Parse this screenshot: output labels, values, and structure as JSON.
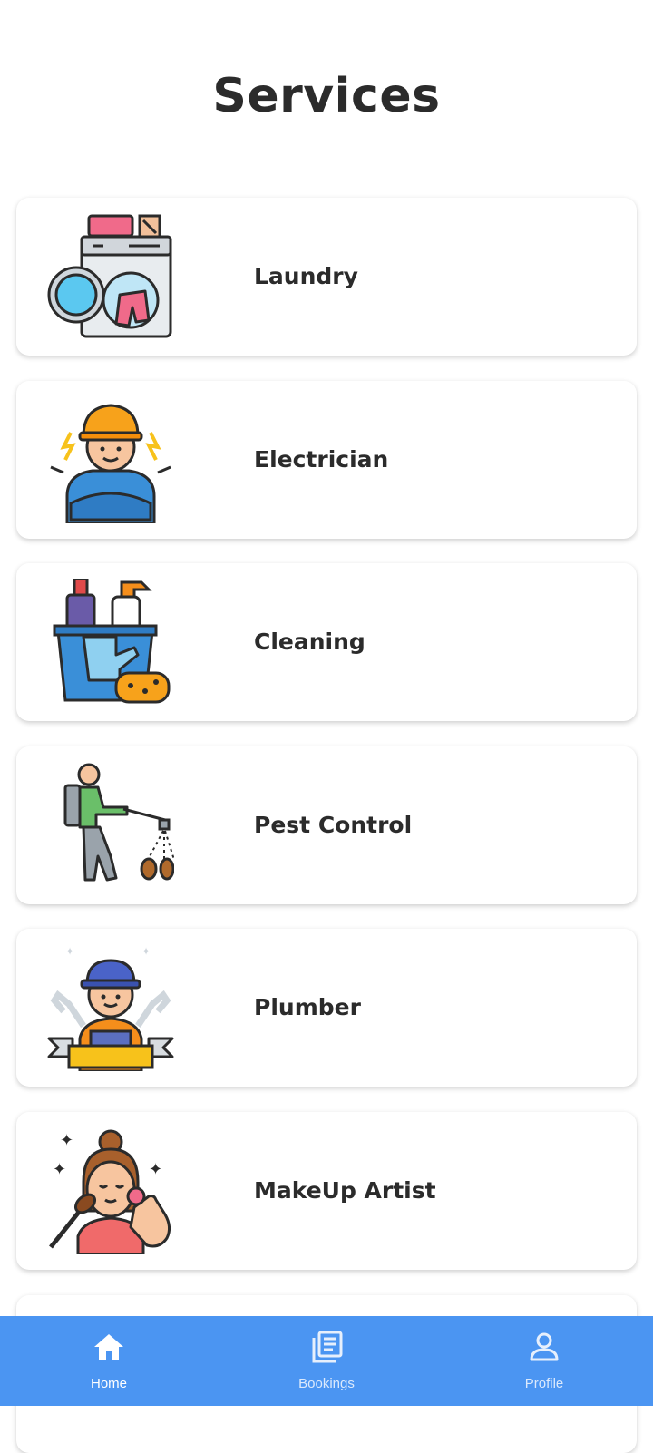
{
  "header": {
    "title": "Services"
  },
  "services": [
    {
      "label": "Laundry",
      "icon": "washing-machine-icon"
    },
    {
      "label": "Electrician",
      "icon": "electrician-worker-icon"
    },
    {
      "label": "Cleaning",
      "icon": "cleaning-bucket-icon"
    },
    {
      "label": "Pest Control",
      "icon": "pest-sprayer-icon"
    },
    {
      "label": "Plumber",
      "icon": "plumber-worker-icon"
    },
    {
      "label": "MakeUp Artist",
      "icon": "makeup-artist-icon"
    }
  ],
  "bottom_nav": {
    "items": [
      {
        "label": "Home",
        "icon": "home-icon",
        "active": true
      },
      {
        "label": "Bookings",
        "icon": "bookings-icon",
        "active": false
      },
      {
        "label": "Profile",
        "icon": "profile-icon",
        "active": false
      }
    ],
    "color": "#4b95f2"
  }
}
